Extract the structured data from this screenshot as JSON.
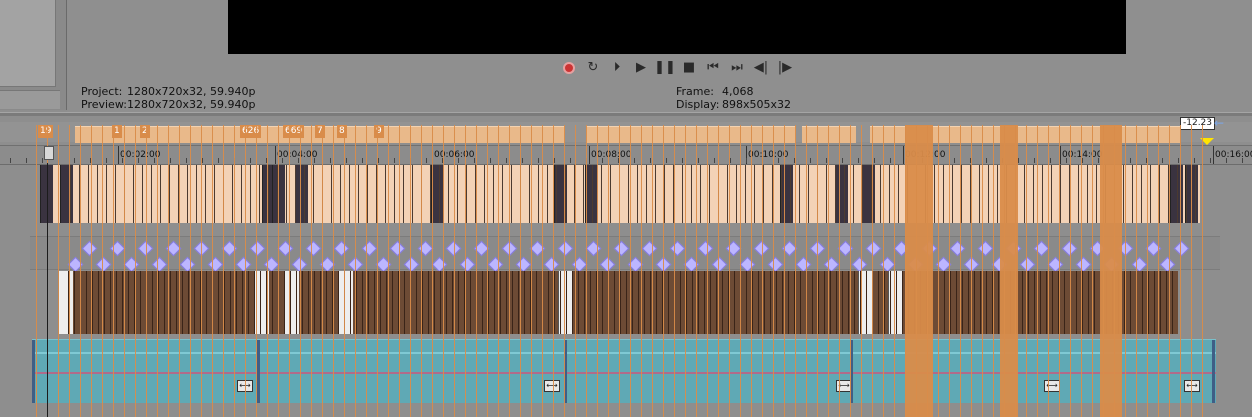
{
  "preview": {
    "project_label": "Project:",
    "project_value": "1280x720x32, 59.940p",
    "preview_label": "Preview:",
    "preview_value": "1280x720x32, 59.940p",
    "frame_label": "Frame:",
    "frame_value": "4,068",
    "display_label": "Display:",
    "display_value": "898x505x32"
  },
  "transport": [
    {
      "name": "record-button",
      "icon": "record-icon",
      "glyph": ""
    },
    {
      "name": "loop-button",
      "icon": "loop-icon",
      "glyph": "↻"
    },
    {
      "name": "play-from-start-button",
      "icon": "play-from-start-icon",
      "glyph": "⏵"
    },
    {
      "name": "play-button",
      "icon": "play-icon",
      "glyph": "▶"
    },
    {
      "name": "pause-button",
      "icon": "pause-icon",
      "glyph": "❚❚"
    },
    {
      "name": "stop-button",
      "icon": "stop-icon",
      "glyph": "■"
    },
    {
      "name": "go-to-start-button",
      "icon": "go-to-start-icon",
      "glyph": "⏮"
    },
    {
      "name": "go-to-end-button",
      "icon": "go-to-end-icon",
      "glyph": "⏭"
    },
    {
      "name": "previous-frame-button",
      "icon": "previous-frame-icon",
      "glyph": "◀|"
    },
    {
      "name": "next-frame-button",
      "icon": "next-frame-icon",
      "glyph": "|▶"
    }
  ],
  "markers": [
    {
      "label": "19"
    },
    {
      "label": "1"
    },
    {
      "label": "2"
    },
    {
      "label": "626"
    },
    {
      "label": "669"
    },
    {
      "label": "7"
    },
    {
      "label": "8"
    },
    {
      "label": "9"
    }
  ],
  "level": "-12.23",
  "ruler": {
    "labels": [
      "00:02:00",
      "00:04:00",
      "00:06:00",
      "00:08:00",
      "00:10:00",
      "00:12:00",
      "00:14:00",
      "00:16:00"
    ],
    "end_label": "00:16:00"
  },
  "colors": {
    "marker_orange": "#d98c4a",
    "region_peach": "#e9b98a",
    "envelope_keyframe": "#bcb6ff",
    "track_teal": "#5fa9b5",
    "audio_brown": "#6d4b35",
    "record_red": "#c33"
  }
}
